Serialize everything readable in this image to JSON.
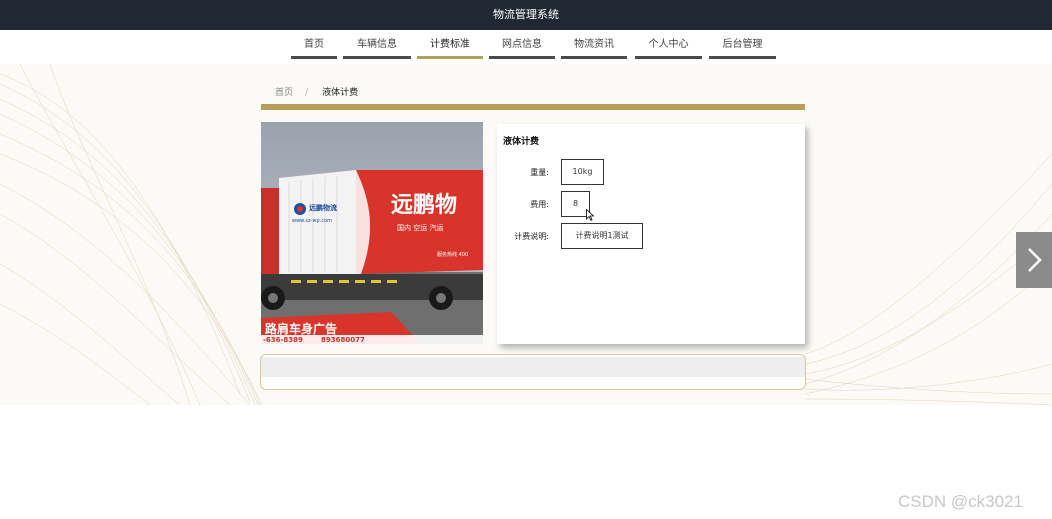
{
  "header": {
    "title": "物流管理系统"
  },
  "nav": {
    "items": [
      {
        "label": "首页",
        "active": false
      },
      {
        "label": "车辆信息",
        "active": false
      },
      {
        "label": "计费标准",
        "active": true
      },
      {
        "label": "网点信息",
        "active": false
      },
      {
        "label": "物流资讯",
        "active": false
      },
      {
        "label": "个人中心",
        "active": false
      },
      {
        "label": "后台管理",
        "active": false
      }
    ]
  },
  "breadcrumb": {
    "home": "首页",
    "separator": "/",
    "current": "液体计费"
  },
  "detail": {
    "title": "液体计费",
    "fields": [
      {
        "label": "重量:",
        "value": "10kg"
      },
      {
        "label": "费用:",
        "value": "8"
      },
      {
        "label": "计费说明:",
        "value": "计费说明1测试"
      }
    ]
  },
  "photo": {
    "brand_text": "远鹏物",
    "sub_text": "国内 空运 汽运",
    "website": "www.sz-wp.com",
    "ad_text": "路肩车身广告",
    "phone_left": "-636-8389",
    "phone_right": "893680077"
  },
  "watermark": "CSDN @ck3021",
  "colors": {
    "topbar": "#1f2833",
    "accent_gold": "#b5a05a",
    "nav_bar": "#4a4a4a",
    "truck_red": "#d9342b"
  },
  "icons": {
    "next": "chevron-right-icon",
    "cursor": "mouse-pointer-icon"
  }
}
